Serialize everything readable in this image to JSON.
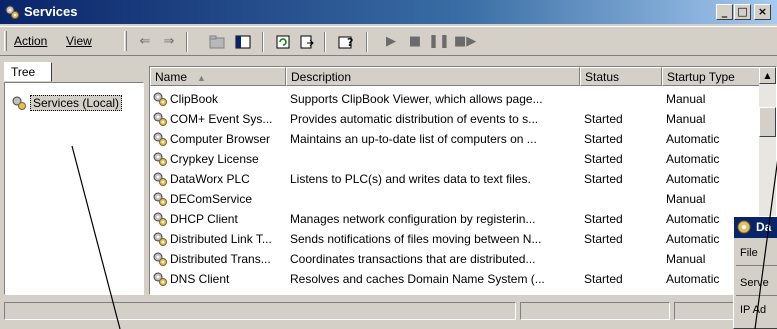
{
  "window": {
    "title": "Services",
    "icon": "services-gear-icon"
  },
  "menu": {
    "action_label": "Action",
    "view_label": "View"
  },
  "toolbar_icons": [
    "back-arrow-icon",
    "forward-arrow-icon",
    "up-folder-icon",
    "show-hide-tree-icon",
    "refresh-icon",
    "export-list-icon",
    "help-icon",
    "start-service-icon",
    "stop-service-icon",
    "pause-service-icon",
    "restart-service-icon"
  ],
  "tree": {
    "tab_label": "Tree",
    "root_label": "Services (Local)"
  },
  "list": {
    "columns": [
      "Name",
      "Description",
      "Status",
      "Startup Type"
    ],
    "rows": [
      {
        "name": "ClipBook",
        "description": "Supports ClipBook Viewer, which allows page...",
        "status": "",
        "startup": "Manual"
      },
      {
        "name": "COM+ Event Sys...",
        "description": "Provides automatic distribution of events to s...",
        "status": "Started",
        "startup": "Manual"
      },
      {
        "name": "Computer Browser",
        "description": "Maintains an up-to-date list of computers on ...",
        "status": "Started",
        "startup": "Automatic"
      },
      {
        "name": "Crypkey License",
        "description": "",
        "status": "Started",
        "startup": "Automatic"
      },
      {
        "name": "DataWorx PLC",
        "description": "Listens to PLC(s) and writes data to text files.",
        "status": "Started",
        "startup": "Automatic"
      },
      {
        "name": "DEComService",
        "description": "",
        "status": "",
        "startup": "Manual"
      },
      {
        "name": "DHCP Client",
        "description": "Manages network configuration by registerin...",
        "status": "Started",
        "startup": "Automatic"
      },
      {
        "name": "Distributed Link T...",
        "description": "Sends notifications of files moving between N...",
        "status": "Started",
        "startup": "Automatic"
      },
      {
        "name": "Distributed Trans...",
        "description": "Coordinates transactions that are distributed...",
        "status": "",
        "startup": "Manual"
      },
      {
        "name": "DNS Client",
        "description": "Resolves and caches Domain Name System (...",
        "status": "Started",
        "startup": "Automatic"
      }
    ]
  },
  "overlay": {
    "title": "Da",
    "menu_text": "File",
    "line1": "Serve",
    "line2": "IP Ad"
  },
  "colors": {
    "titlebar": "#0a246a",
    "face": "#d4d0c8"
  }
}
